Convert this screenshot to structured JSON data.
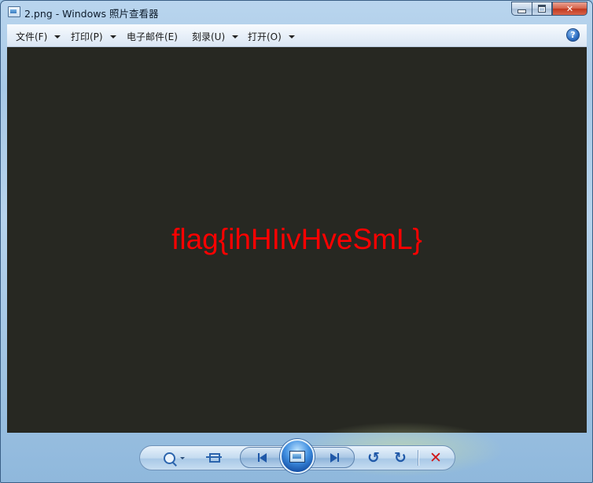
{
  "window": {
    "title": "2.png - Windows 照片查看器",
    "caption_buttons": {
      "minimize": "minimize-icon",
      "maximize": "maximize-icon",
      "close": "close-icon"
    }
  },
  "menu": {
    "items": [
      {
        "label": "文件(F)",
        "has_dropdown": true
      },
      {
        "label": "打印(P)",
        "has_dropdown": true
      },
      {
        "label": "电子邮件(E)",
        "has_dropdown": false
      },
      {
        "label": "刻录(U)",
        "has_dropdown": true
      },
      {
        "label": "打开(O)",
        "has_dropdown": true
      }
    ],
    "help": "?"
  },
  "image": {
    "text": "flag{ihHIivHveSmL}",
    "text_color": "#ff0000",
    "background": "#272822"
  },
  "controls": {
    "zoom": "zoom-icon",
    "fit": "actual-size-icon",
    "previous": "previous-icon",
    "slideshow": "slideshow-icon",
    "next": "next-icon",
    "rotate_left": "rotate-counterclockwise-icon",
    "rotate_right": "rotate-clockwise-icon",
    "delete": "delete-icon"
  }
}
